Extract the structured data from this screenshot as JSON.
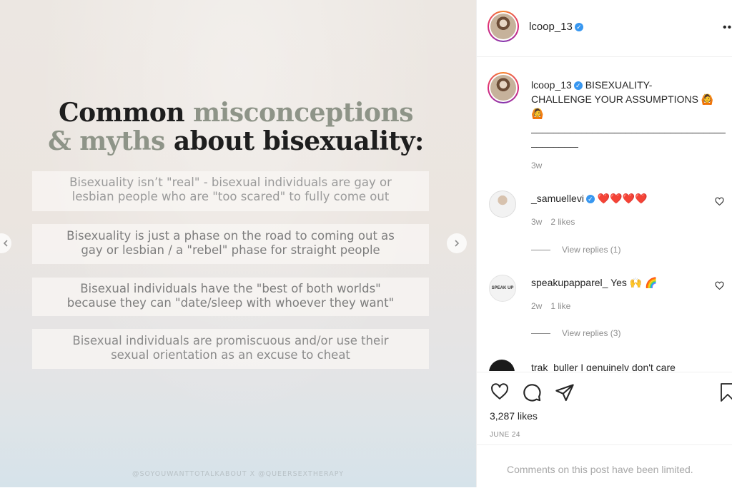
{
  "post_image": {
    "heading_line1": {
      "dark": "Common ",
      "muted": "misconceptions"
    },
    "heading_line2": {
      "muted": "& myths ",
      "dark": "about bisexuality:"
    },
    "myths": [
      [
        "Bisexuality isn’t \"real\" - bisexual individuals are gay or",
        "lesbian people who are \"too scared\" to fully come out"
      ],
      [
        "Bisexuality is just a phase on the road to coming out as",
        "gay or lesbian / a \"rebel\" phase for straight people"
      ],
      [
        "Bisexual individuals have the \"best of both worlds\"",
        "because they can \"date/sleep with whoever they want\""
      ],
      [
        "Bisexual individuals are promiscuous and/or use their",
        "sexual orientation as an excuse to cheat"
      ]
    ],
    "credit": "@SOYOUWANTTOTALKABOUT X @QUEERSEXTHERAPY"
  },
  "header": {
    "username": "lcoop_13",
    "more_icon": "more-horizontal-icon"
  },
  "caption": {
    "username": "lcoop_13",
    "text_line1": "BISEXUALITY-",
    "text_line2": "CHALLENGE YOUR ASSUMPTIONS",
    "emoji1": "🙆",
    "emoji2": "🙆",
    "divider": "____________________________________________",
    "time": "3w"
  },
  "comments": [
    {
      "username": "_samuellevi",
      "verified": true,
      "text": "❤️❤️❤️❤️",
      "time": "3w",
      "likes": "2 likes",
      "replies": "View replies (1)"
    },
    {
      "username": "speakupapparel_",
      "verified": false,
      "text": "Yes 🙌 🌈",
      "time": "2w",
      "likes": "1 like",
      "replies": "View replies (3)",
      "avatar_text": "SPEAK UP"
    },
    {
      "username": "trak_buller",
      "verified": false,
      "text": "I genuinely don't care"
    }
  ],
  "actions": {
    "like_icon": "heart-icon",
    "comment_icon": "comment-icon",
    "share_icon": "share-icon",
    "save_icon": "bookmark-icon"
  },
  "likes": "3,287 likes",
  "date": "JUNE 24",
  "footer": {
    "notice": "Comments on this post have been limited."
  },
  "colors": {
    "verified": "#3897f0",
    "muted_heading": "#8e9488",
    "secondary_text": "#8e8e8e"
  }
}
